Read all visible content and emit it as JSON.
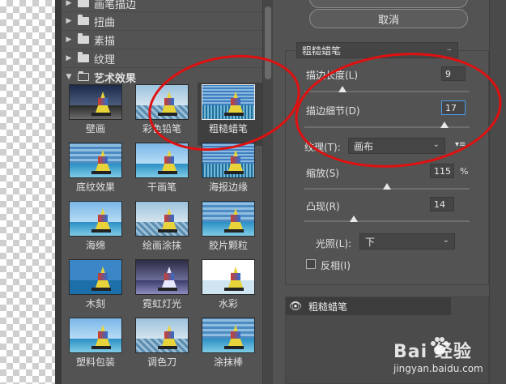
{
  "gallery": {
    "categories": [
      {
        "label": "画笔描边",
        "state": "collapsed"
      },
      {
        "label": "扭曲",
        "state": "collapsed"
      },
      {
        "label": "素描",
        "state": "collapsed"
      },
      {
        "label": "纹理",
        "state": "collapsed"
      },
      {
        "label": "艺术效果",
        "state": "expanded"
      }
    ],
    "filters": [
      {
        "label": "壁画",
        "selected": false
      },
      {
        "label": "彩色铅笔",
        "selected": false
      },
      {
        "label": "粗糙蜡笔",
        "selected": true
      },
      {
        "label": "底纹效果",
        "selected": false
      },
      {
        "label": "干画笔",
        "selected": false
      },
      {
        "label": "海报边缘",
        "selected": false
      },
      {
        "label": "海绵",
        "selected": false
      },
      {
        "label": "绘画涂抹",
        "selected": false
      },
      {
        "label": "胶片颗粒",
        "selected": false
      },
      {
        "label": "木刻",
        "selected": false
      },
      {
        "label": "霓虹灯光",
        "selected": false
      },
      {
        "label": "水彩",
        "selected": false
      },
      {
        "label": "塑料包装",
        "selected": false
      },
      {
        "label": "调色刀",
        "selected": false
      },
      {
        "label": "涂抹棒",
        "selected": false
      }
    ]
  },
  "buttons": {
    "cancel_label": "取消"
  },
  "settings": {
    "filter_select": "粗糙蜡笔",
    "stroke_length": {
      "label": "描边长度(L)",
      "value": "9",
      "slider_fraction": 0.23
    },
    "stroke_detail": {
      "label": "描边细节(D)",
      "value": "17",
      "slider_fraction": 0.85
    },
    "texture": {
      "label": "纹理(T):",
      "value": "画布",
      "menu_icon": "▾≡"
    },
    "scaling": {
      "label": "缩放(S)",
      "value": "115",
      "unit": "%",
      "slider_fraction": 0.5
    },
    "relief": {
      "label": "凸现(R)",
      "value": "14",
      "slider_fraction": 0.3
    },
    "light": {
      "label": "光照(L):",
      "value": "下"
    },
    "invert": {
      "label": "反相(I)",
      "checked": false
    }
  },
  "layers": {
    "effect_name": "粗糙蜡笔",
    "visible": true
  },
  "watermark": {
    "brand": "Bai 经验",
    "url": "jingyan.baidu.com"
  },
  "colors": {
    "panel_bg": "#535353",
    "annotation": "#e01010",
    "focus": "#4a9bf0"
  }
}
